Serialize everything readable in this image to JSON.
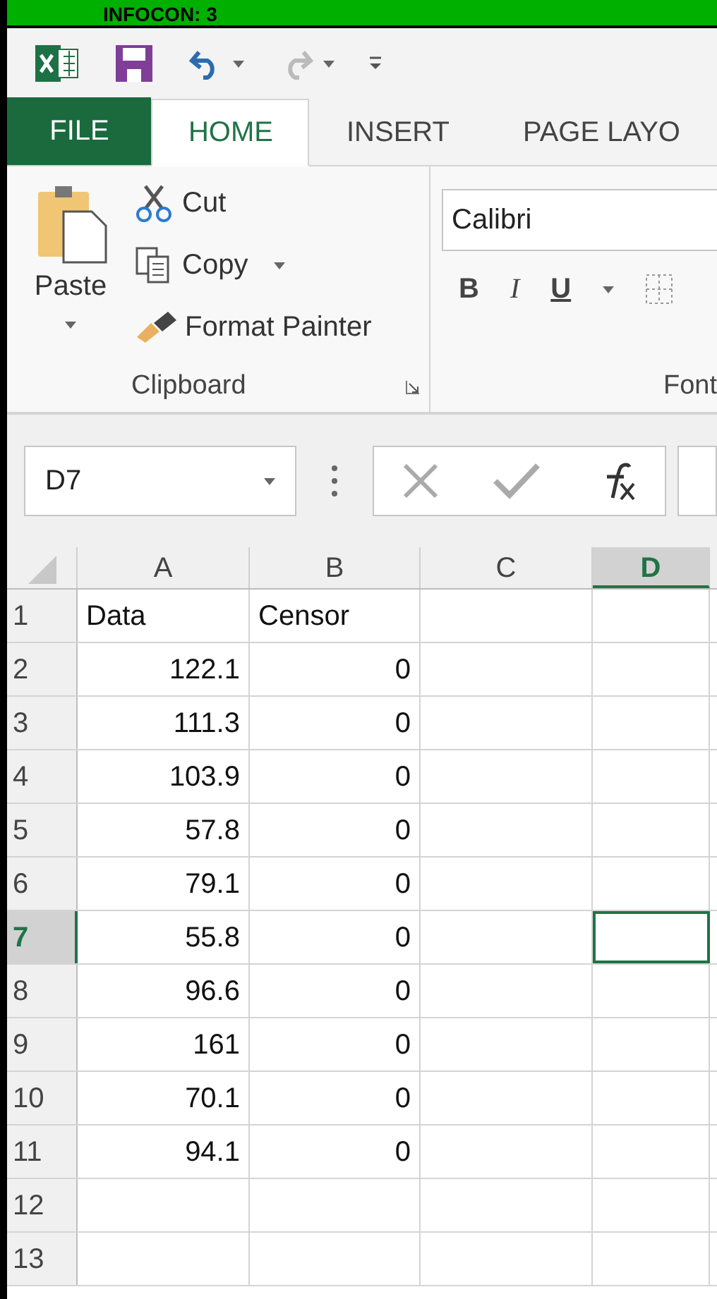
{
  "banner": {
    "text": "INFOCON: 3"
  },
  "ribbon_tabs": [
    {
      "label": "FILE",
      "kind": "file",
      "selected": false
    },
    {
      "label": "HOME",
      "kind": "tab",
      "selected": true
    },
    {
      "label": "INSERT",
      "kind": "tab",
      "selected": false
    },
    {
      "label": "PAGE LAYO",
      "kind": "tab",
      "selected": false
    }
  ],
  "clipboard": {
    "paste": "Paste",
    "cut": "Cut",
    "copy": "Copy",
    "format_painter": "Format Painter",
    "group_label": "Clipboard"
  },
  "font": {
    "name": "Calibri",
    "bold": "B",
    "italic": "I",
    "underline": "U",
    "group_label": "Font"
  },
  "name_box": "D7",
  "columns": [
    {
      "label": "A",
      "selected": false
    },
    {
      "label": "B",
      "selected": false
    },
    {
      "label": "C",
      "selected": false
    },
    {
      "label": "D",
      "selected": true
    }
  ],
  "rows": [
    {
      "number": "1",
      "selected": false,
      "a": "Data",
      "b": "Censor"
    },
    {
      "number": "2",
      "selected": false,
      "a": "122.1",
      "b": "0"
    },
    {
      "number": "3",
      "selected": false,
      "a": "111.3",
      "b": "0"
    },
    {
      "number": "4",
      "selected": false,
      "a": "103.9",
      "b": "0"
    },
    {
      "number": "5",
      "selected": false,
      "a": "57.8",
      "b": "0"
    },
    {
      "number": "6",
      "selected": false,
      "a": "79.1",
      "b": "0"
    },
    {
      "number": "7",
      "selected": true,
      "a": "55.8",
      "b": "0"
    },
    {
      "number": "8",
      "selected": false,
      "a": "96.6",
      "b": "0"
    },
    {
      "number": "9",
      "selected": false,
      "a": "161",
      "b": "0"
    },
    {
      "number": "10",
      "selected": false,
      "a": "70.1",
      "b": "0"
    },
    {
      "number": "11",
      "selected": false,
      "a": "94.1",
      "b": "0"
    },
    {
      "number": "12",
      "selected": false
    },
    {
      "number": "13",
      "selected": false
    }
  ]
}
